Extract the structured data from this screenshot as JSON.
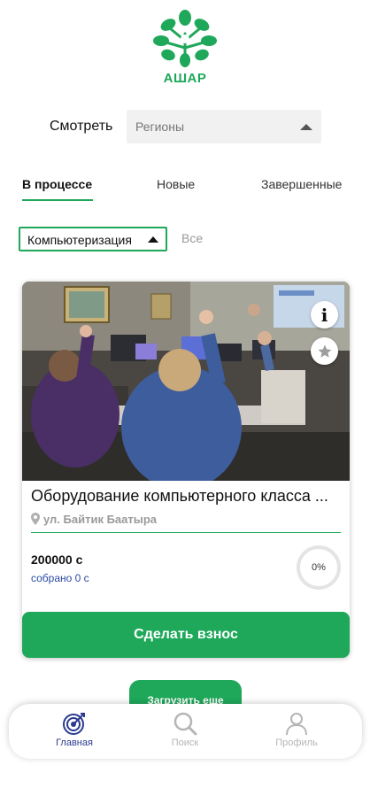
{
  "brand": {
    "name": "АШАР",
    "color": "#1fa85a"
  },
  "filter": {
    "label": "Смотреть",
    "value": "Регионы",
    "icon": "caret-up-icon"
  },
  "tabs": [
    {
      "label": "В процессе",
      "active": true
    },
    {
      "label": "Новые",
      "active": false
    },
    {
      "label": "Завершенные",
      "active": false
    }
  ],
  "categories": {
    "selected": "Компьютеризация",
    "all_label": "Все"
  },
  "card": {
    "title": "Оборудование компьютерного класса ...",
    "address": "ул. Байтик Баатыра",
    "amount": "200000 с",
    "collected": "собрано 0 с",
    "progress": "0%",
    "progress_value": 0,
    "donate_label": "Сделать взнос",
    "info_label": "i",
    "photo_icon": "classroom-photo",
    "favorite_icon": "star-icon"
  },
  "load_more_label": "Загрузить еще",
  "bottom_nav": [
    {
      "label": "Главная",
      "icon": "target-icon",
      "active": true
    },
    {
      "label": "Поиск",
      "icon": "search-icon",
      "active": false
    },
    {
      "label": "Профиль",
      "icon": "profile-icon",
      "active": false
    }
  ],
  "colors": {
    "accent": "#1fa85a",
    "nav_active": "#2b3a8f",
    "link": "#2b4aa3"
  }
}
